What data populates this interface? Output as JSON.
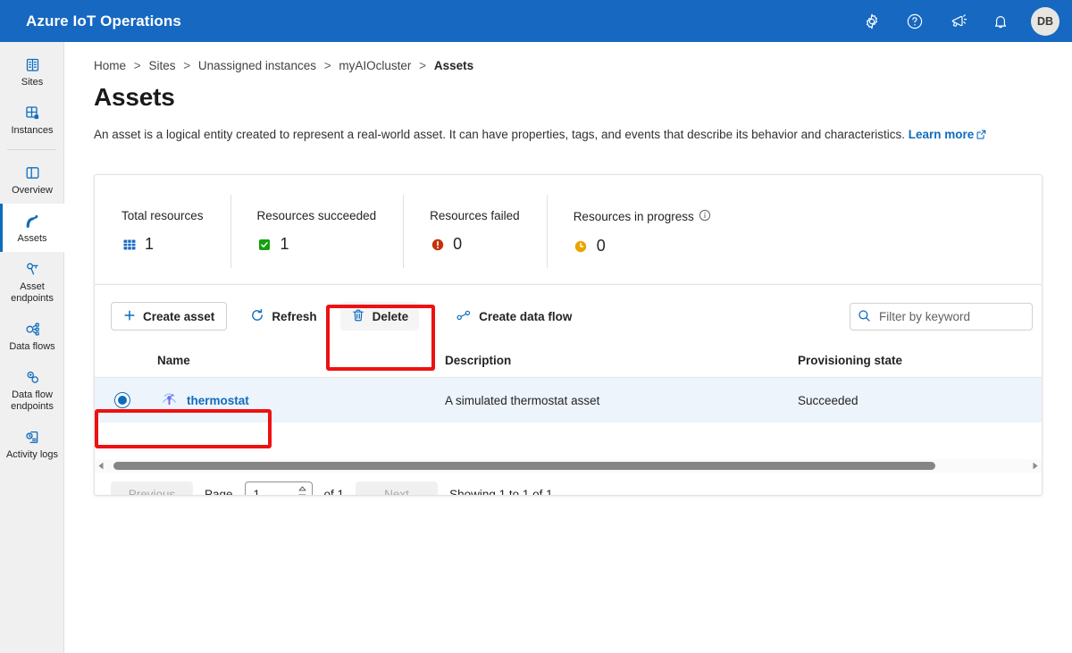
{
  "header": {
    "brand": "Azure IoT Operations",
    "icons": [
      {
        "name": "gear-icon",
        "label": "Settings"
      },
      {
        "name": "help-icon",
        "label": "Help"
      },
      {
        "name": "megaphone-icon",
        "label": "Feedback"
      },
      {
        "name": "bell-icon",
        "label": "Notifications"
      }
    ],
    "avatar_initials": "DB",
    "background_color": "#1668c1"
  },
  "sidebar": {
    "items": [
      {
        "label": "Sites",
        "icon": "sites-icon",
        "selected": false
      },
      {
        "label": "Instances",
        "icon": "instances-icon",
        "selected": false
      },
      {
        "label": "Overview",
        "icon": "overview-icon",
        "selected": false
      },
      {
        "label": "Assets",
        "icon": "assets-icon",
        "selected": true
      },
      {
        "label": "Asset endpoints",
        "icon": "asset-endpoints-icon",
        "selected": false
      },
      {
        "label": "Data flows",
        "icon": "data-flows-icon",
        "selected": false
      },
      {
        "label": "Data flow endpoints",
        "icon": "data-flow-endpoints-icon",
        "selected": false
      },
      {
        "label": "Activity logs",
        "icon": "activity-logs-icon",
        "selected": false
      }
    ],
    "accent_color": "#0f6cbd"
  },
  "breadcrumb": {
    "items": [
      "Home",
      "Sites",
      "Unassigned instances",
      "myAIOcluster",
      "Assets"
    ],
    "separator": ">"
  },
  "page": {
    "title": "Assets",
    "description": "An asset is a logical entity created to represent a real-world asset. It can have properties, tags, and events that describe its behavior and characteristics.",
    "learn_more": "Learn more"
  },
  "stats": [
    {
      "label": "Total resources",
      "value": "1",
      "icon": "grid-icon",
      "color": "#1668c1",
      "info": false
    },
    {
      "label": "Resources succeeded",
      "value": "1",
      "icon": "success-check-icon",
      "color": "#13a10e",
      "info": false
    },
    {
      "label": "Resources failed",
      "value": "0",
      "icon": "error-circle-icon",
      "color": "#c4320a",
      "info": false
    },
    {
      "label": "Resources in progress",
      "value": "0",
      "icon": "clock-icon",
      "color": "#eaa300",
      "info": true
    }
  ],
  "toolbar": {
    "create_asset": "Create asset",
    "refresh": "Refresh",
    "delete": "Delete",
    "create_data_flow": "Create data flow"
  },
  "search": {
    "placeholder": "Filter by keyword",
    "value": ""
  },
  "table": {
    "columns": [
      "Name",
      "Description",
      "Provisioning state"
    ],
    "rows": [
      {
        "selected": true,
        "name": "thermostat",
        "description": "A simulated thermostat asset",
        "provisioning_state": "Succeeded"
      }
    ]
  },
  "pagination": {
    "previous": "Previous",
    "page_label": "Page",
    "page_value": "1",
    "of_label": "of 1",
    "next": "Next",
    "showing": "Showing 1 to 1 of 1"
  },
  "annotations": {
    "color": "#ee1111",
    "boxes": [
      "delete-button-highlight",
      "selected-row-highlight"
    ]
  }
}
